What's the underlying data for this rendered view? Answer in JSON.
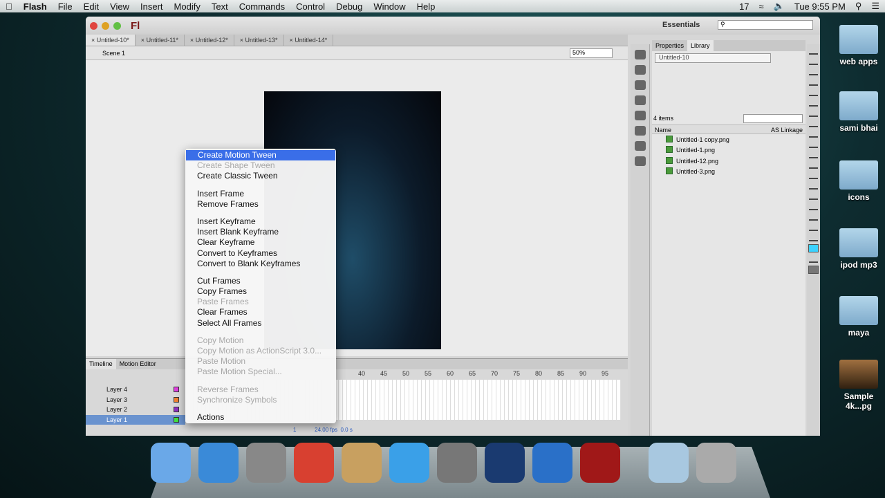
{
  "menubar": {
    "app": "Flash",
    "items": [
      "File",
      "Edit",
      "View",
      "Insert",
      "Modify",
      "Text",
      "Commands",
      "Control",
      "Debug",
      "Window",
      "Help"
    ],
    "status": [
      "17"
    ],
    "clock": "Tue 9:55 PM"
  },
  "window": {
    "logo": "Fl",
    "workspace": "Essentials",
    "zoom": "50%",
    "scene": "Scene 1",
    "tabs": [
      "Untitled-10*",
      "Untitled-11*",
      "Untitled-12*",
      "Untitled-13*",
      "Untitled-14*"
    ]
  },
  "timeline": {
    "tabs": [
      "Timeline",
      "Motion Editor"
    ],
    "ruler": [
      "40",
      "45",
      "50",
      "55",
      "60",
      "65",
      "70",
      "75",
      "80",
      "85",
      "90",
      "95"
    ],
    "layers": [
      {
        "name": "Layer 4",
        "color": "#e040e0"
      },
      {
        "name": "Layer 3",
        "color": "#f08030"
      },
      {
        "name": "Layer 2",
        "color": "#9030c0"
      },
      {
        "name": "Layer 1",
        "color": "#40e040"
      }
    ],
    "frame": "1",
    "fps": "24.00 fps",
    "time": "0.0 s"
  },
  "library": {
    "tabs": [
      "Properties",
      "Library"
    ],
    "document": "Untitled-10",
    "count": "4 items",
    "col_name": "Name",
    "col_linkage": "AS Linkage",
    "items": [
      "Untitled-1 copy.png",
      "Untitled-1.png",
      "Untitled-12.png",
      "Untitled-3.png"
    ]
  },
  "tools": {
    "fill_color": "#3cd2ff"
  },
  "desktop": [
    "web apps",
    "sami bhai",
    "icons",
    "ipod mp3",
    "maya",
    "Sample 4k...pg"
  ],
  "context_menu": [
    {
      "label": "Create Motion Tween",
      "state": "highlighted"
    },
    {
      "label": "Create Shape Tween",
      "state": "disabled"
    },
    {
      "label": "Create Classic Tween"
    },
    {
      "sep": true
    },
    {
      "label": "Insert Frame"
    },
    {
      "label": "Remove Frames"
    },
    {
      "sep": true
    },
    {
      "label": "Insert Keyframe"
    },
    {
      "label": "Insert Blank Keyframe"
    },
    {
      "label": "Clear Keyframe"
    },
    {
      "label": "Convert to Keyframes"
    },
    {
      "label": "Convert to Blank Keyframes"
    },
    {
      "sep": true
    },
    {
      "label": "Cut Frames"
    },
    {
      "label": "Copy Frames"
    },
    {
      "label": "Paste Frames",
      "state": "disabled"
    },
    {
      "label": "Clear Frames"
    },
    {
      "label": "Select All Frames"
    },
    {
      "sep": true
    },
    {
      "label": "Copy Motion",
      "state": "disabled"
    },
    {
      "label": "Copy Motion as ActionScript 3.0...",
      "state": "disabled"
    },
    {
      "label": "Paste Motion",
      "state": "disabled"
    },
    {
      "label": "Paste Motion Special...",
      "state": "disabled"
    },
    {
      "sep": true
    },
    {
      "label": "Reverse Frames",
      "state": "disabled"
    },
    {
      "label": "Synchronize Symbols",
      "state": "disabled"
    },
    {
      "sep": true
    },
    {
      "label": "Actions"
    }
  ],
  "dock": [
    {
      "name": "finder",
      "color": "#6aa8e8"
    },
    {
      "name": "safari",
      "color": "#3a8ad8"
    },
    {
      "name": "launchpad",
      "color": "#888"
    },
    {
      "name": "chrome",
      "color": "#d84030"
    },
    {
      "name": "preview",
      "color": "#c8a060"
    },
    {
      "name": "itunes",
      "color": "#3aa0e8"
    },
    {
      "name": "system-preferences",
      "color": "#777"
    },
    {
      "name": "photoshop",
      "color": "#1a3a70"
    },
    {
      "name": "quicktime",
      "color": "#2a70c8"
    },
    {
      "name": "flash",
      "color": "#a01818"
    },
    {
      "name": "downloads",
      "color": "#a8c8e0"
    },
    {
      "name": "trash",
      "color": "#aaa"
    }
  ]
}
